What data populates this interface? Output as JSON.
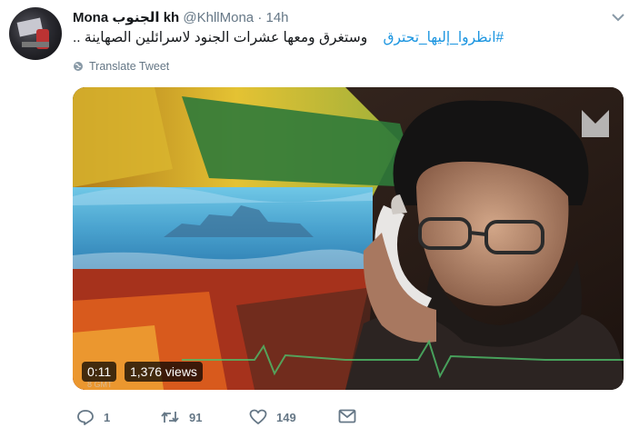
{
  "tweet": {
    "display_name": "Mona الجنوب kh",
    "handle": "@KhllMona",
    "separator": "·",
    "time": "14h",
    "hashtag": "#انظروا_إليها_تحترق",
    "body": "وستغرق ومعها عشرات الجنود لاسرائلين الصهاينة ..",
    "translate_label": "Translate Tweet"
  },
  "video": {
    "duration": "0:11",
    "views": "1,376 views"
  },
  "actions": {
    "reply_count": "1",
    "retweet_count": "91",
    "like_count": "149"
  },
  "icons": {
    "caret": "chevron-down-icon",
    "translate": "globe-icon",
    "reply": "reply-icon",
    "retweet": "retweet-icon",
    "like": "heart-icon",
    "dm": "envelope-icon"
  },
  "colors": {
    "link": "#1b95e0",
    "secondary": "#657786",
    "text": "#14171a"
  }
}
